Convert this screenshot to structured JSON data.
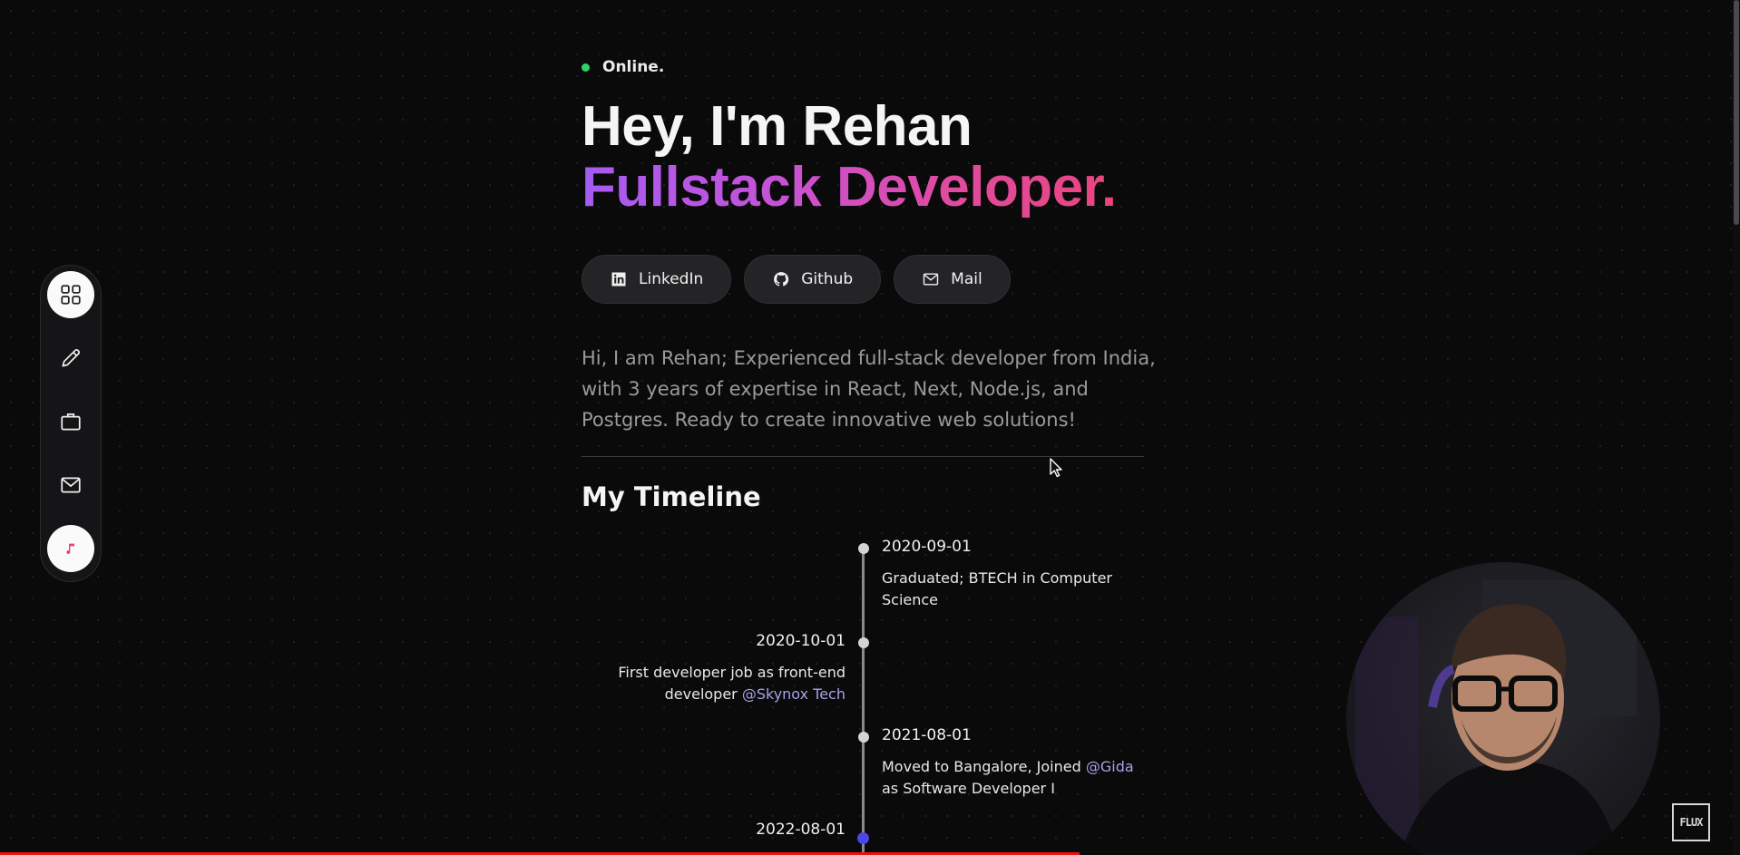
{
  "status": {
    "label": "Online."
  },
  "hero": {
    "greeting": "Hey, I'm ",
    "name": "Rehan",
    "role": "Fullstack Developer."
  },
  "links": [
    {
      "label": "LinkedIn",
      "icon": "linkedin-icon"
    },
    {
      "label": "Github",
      "icon": "github-icon"
    },
    {
      "label": "Mail",
      "icon": "mail-icon"
    }
  ],
  "bio": "Hi, I am Rehan; Experienced full-stack developer from India, with 3 years of expertise in React, Next, Node.js, and Postgres. Ready to create innovative web solutions!",
  "timeline": {
    "title": "My Timeline",
    "events": [
      {
        "date": "2020-09-01",
        "text": "Graduated; BTECH in Computer Science",
        "mention": "",
        "suffix": ""
      },
      {
        "date": "2020-10-01",
        "text": "First developer job as front-end developer ",
        "mention": "@Skynox Tech",
        "suffix": ""
      },
      {
        "date": "2021-08-01",
        "text": "Moved to Bangalore, Joined ",
        "mention": "@Gida",
        "suffix": " as Software Developer I"
      },
      {
        "date": "2022-08-01",
        "text": "",
        "mention": "",
        "suffix": ""
      }
    ]
  },
  "sidebar": {
    "items": [
      {
        "icon": "grid-icon",
        "active": true
      },
      {
        "icon": "pencil-icon",
        "active": false
      },
      {
        "icon": "briefcase-icon",
        "active": false
      },
      {
        "icon": "mail-icon",
        "active": false
      },
      {
        "icon": "music-note-icon",
        "active": false
      }
    ]
  },
  "overlay": {
    "logo_text": "FLUX"
  },
  "colors": {
    "status_dot": "#2fd26a",
    "name_underline": "#4a3cf0",
    "gradient_start": "#a35cf2",
    "gradient_end": "#e8457d",
    "mention": "#a5a2e8",
    "current_dot": "#4c47e6"
  }
}
